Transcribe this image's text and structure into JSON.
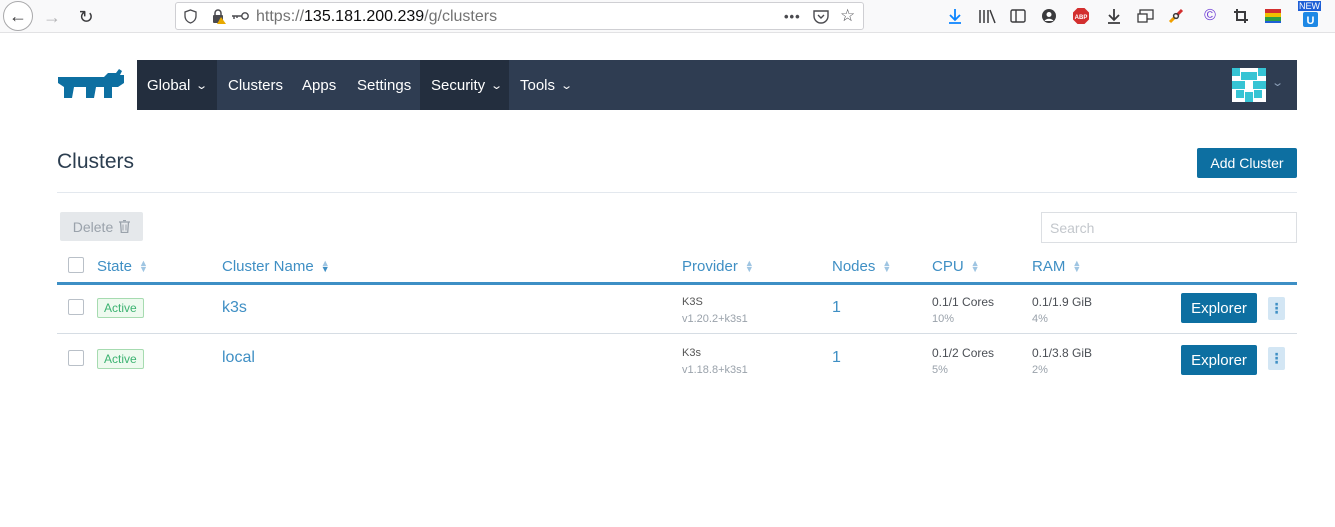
{
  "browser": {
    "url_prefix": "https://",
    "url_host": "135.181.200.239",
    "url_path": "/g/clusters",
    "new_badge": "NEW"
  },
  "nav": {
    "global": "Global",
    "clusters": "Clusters",
    "apps": "Apps",
    "settings": "Settings",
    "security": "Security",
    "tools": "Tools"
  },
  "page": {
    "title": "Clusters",
    "add_cluster": "Add Cluster",
    "delete": "Delete",
    "search_placeholder": "Search"
  },
  "table": {
    "columns": {
      "state": "State",
      "name": "Cluster Name",
      "provider": "Provider",
      "nodes": "Nodes",
      "cpu": "CPU",
      "ram": "RAM"
    },
    "rows": [
      {
        "state": "Active",
        "name": "k3s",
        "provider": "K3S",
        "provider_version": "v1.20.2+k3s1",
        "nodes": "1",
        "cpu": "0.1/1 Cores",
        "cpu_pct": "10%",
        "ram": "0.1/1.9 GiB",
        "ram_pct": "4%",
        "action": "Explorer"
      },
      {
        "state": "Active",
        "name": "local",
        "provider": "K3s",
        "provider_version": "v1.18.8+k3s1",
        "nodes": "1",
        "cpu": "0.1/2 Cores",
        "cpu_pct": "5%",
        "ram": "0.1/3.8 GiB",
        "ram_pct": "2%",
        "action": "Explorer"
      }
    ]
  },
  "colors": {
    "nav_bg": "#2f3d52",
    "nav_active": "#232e3e",
    "primary": "#0d6fa1",
    "link": "#3f8fc4",
    "active_badge": "#3cb371"
  }
}
